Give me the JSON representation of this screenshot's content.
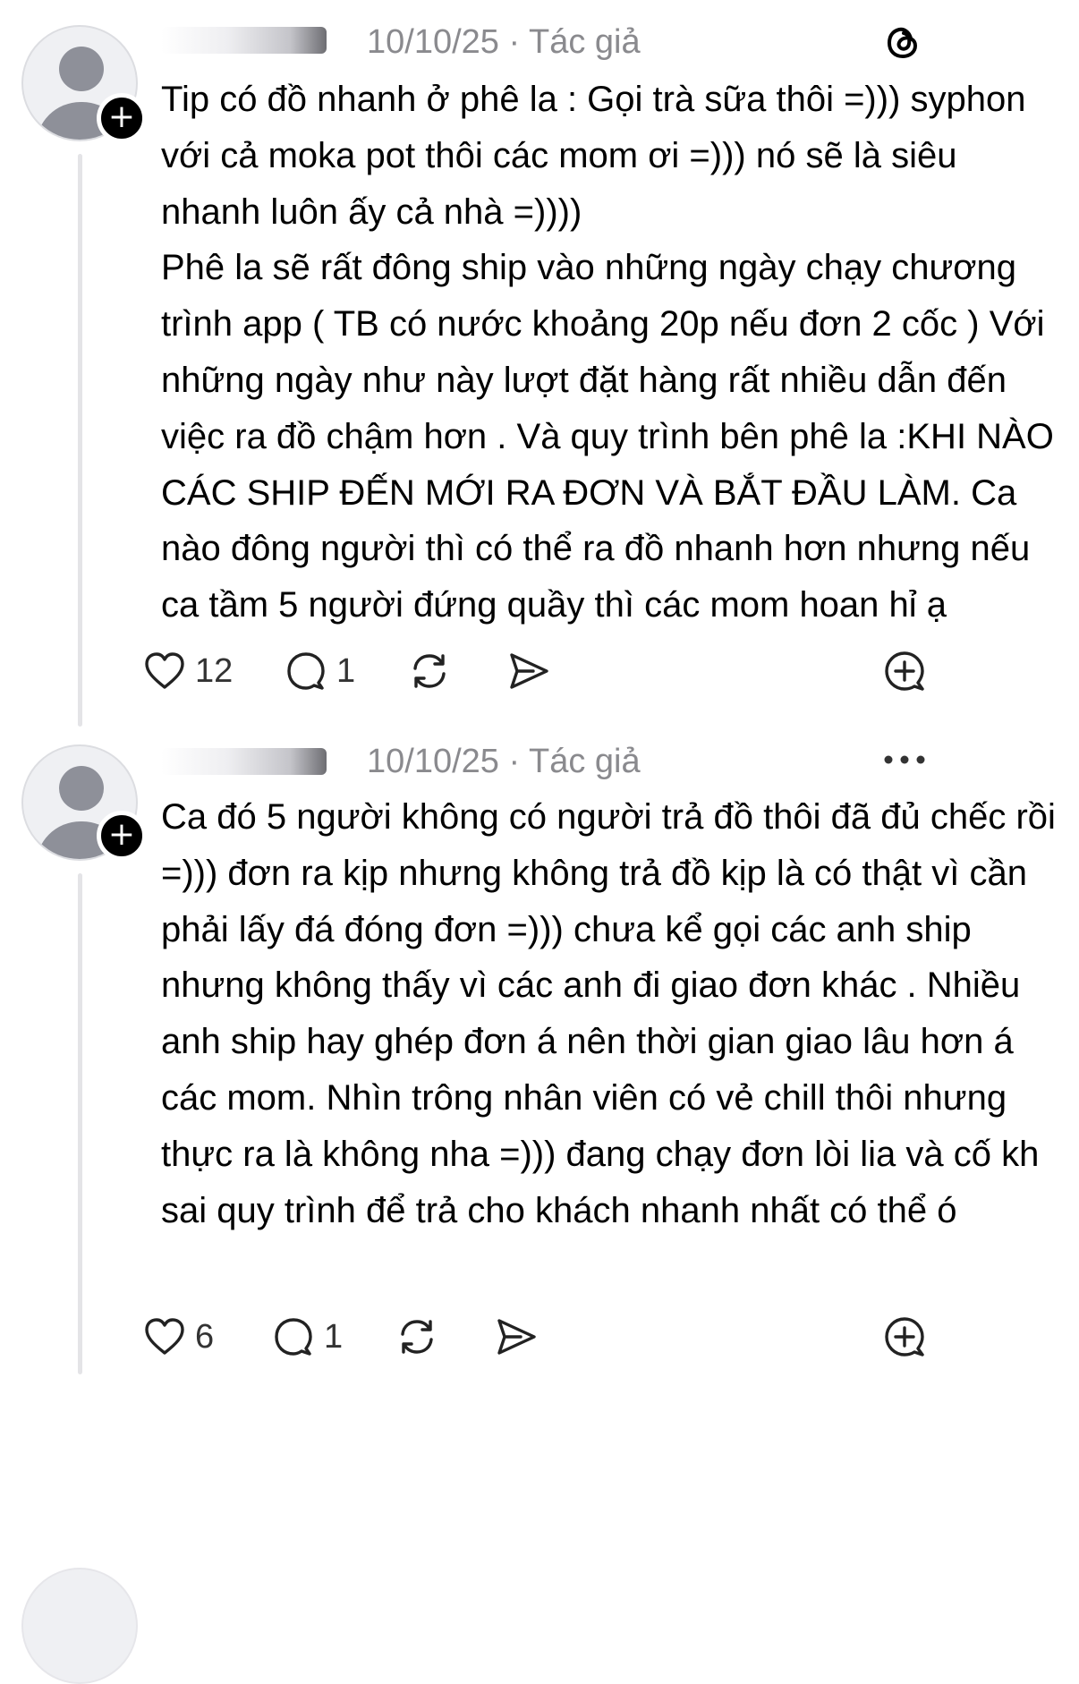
{
  "posts": [
    {
      "date": "10/10/25",
      "separator": "·",
      "role": "Tác giả",
      "paragraphs": [
        "Tip có đồ nhanh ở phê la : Gọi trà sữa thôi =))) syphon với cả moka pot thôi các mom ơi =))) nó sẽ là siêu nhanh luôn ấy cả nhà =))))",
        "Phê la sẽ rất đông ship vào những ngày chạy chương trình app ( TB có nước khoảng 20p nếu đơn 2 cốc ) Với những ngày như này lượt đặt hàng rất nhiều dẫn đến việc ra đồ chậm hơn . Và quy trình bên phê la :KHI NÀO CÁC SHIP ĐẾN MỚI RA ĐƠN VÀ BẮT ĐẦU LÀM. Ca nào đông người thì có thể ra đồ nhanh hơn nhưng nếu ca tầm 5 người đứng quầy thì các mom hoan hỉ ạ"
      ],
      "likes": "12",
      "replies": "1",
      "corner_icon": "threads-logo-icon"
    },
    {
      "date": "10/10/25",
      "separator": "·",
      "role": "Tác giả",
      "paragraphs": [
        "Ca đó 5 người không có người trả đồ thôi đã đủ chếc rồi =))) đơn ra kịp nhưng không trả đồ kịp là có thật vì cần phải lấy đá đóng đơn =))) chưa kể gọi các anh ship nhưng không thấy vì các anh đi giao đơn khác . Nhiều anh ship hay ghép đơn á nên thời gian giao lâu hơn á các mom. Nhìn trông nhân viên có vẻ chill thôi nhưng thực ra là không nha =))) đang chạy đơn lòi lia và cố kh sai quy trình để trả cho khách nhanh nhất có thể ó"
      ],
      "likes": "6",
      "replies": "1",
      "corner_icon": "more-options-icon"
    }
  ]
}
